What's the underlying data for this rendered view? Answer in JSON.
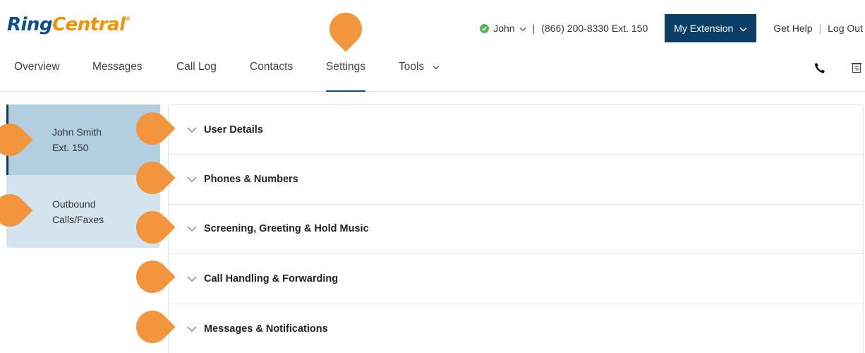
{
  "logo": {
    "part1": "Ring",
    "part2": "Central",
    "reg": "®"
  },
  "header": {
    "user_name": "John",
    "phone": "(866) 200-8330 Ext. 150",
    "separator": "|",
    "extension_button": "My Extension",
    "get_help": "Get Help",
    "log_out": "Log Out",
    "link_separator": "|"
  },
  "nav": {
    "items": [
      {
        "label": "Overview"
      },
      {
        "label": "Messages"
      },
      {
        "label": "Call Log"
      },
      {
        "label": "Contacts"
      },
      {
        "label": "Settings",
        "active": true
      },
      {
        "label": "Tools",
        "has_dropdown": true
      }
    ],
    "icons": [
      "phone-icon",
      "fax-icon"
    ]
  },
  "sidebar": {
    "items": [
      {
        "line1": "John Smith",
        "line2": "Ext. 150",
        "selected": true
      },
      {
        "line1": "Outbound",
        "line2": "Calls/Faxes",
        "selected": false
      }
    ]
  },
  "sections": [
    {
      "title": "User Details"
    },
    {
      "title": "Phones & Numbers"
    },
    {
      "title": "Screening, Greeting & Hold Music"
    },
    {
      "title": "Call Handling & Forwarding"
    },
    {
      "title": "Messages & Notifications"
    }
  ],
  "colors": {
    "brand_blue": "#0a4f8f",
    "brand_orange": "#f39200",
    "button_navy": "#0a3e66",
    "sidebar_selected": "#b3cedf",
    "sidebar_bg": "#d4e4ef",
    "marker": "#f3953c",
    "status_green": "#5bb35b"
  }
}
